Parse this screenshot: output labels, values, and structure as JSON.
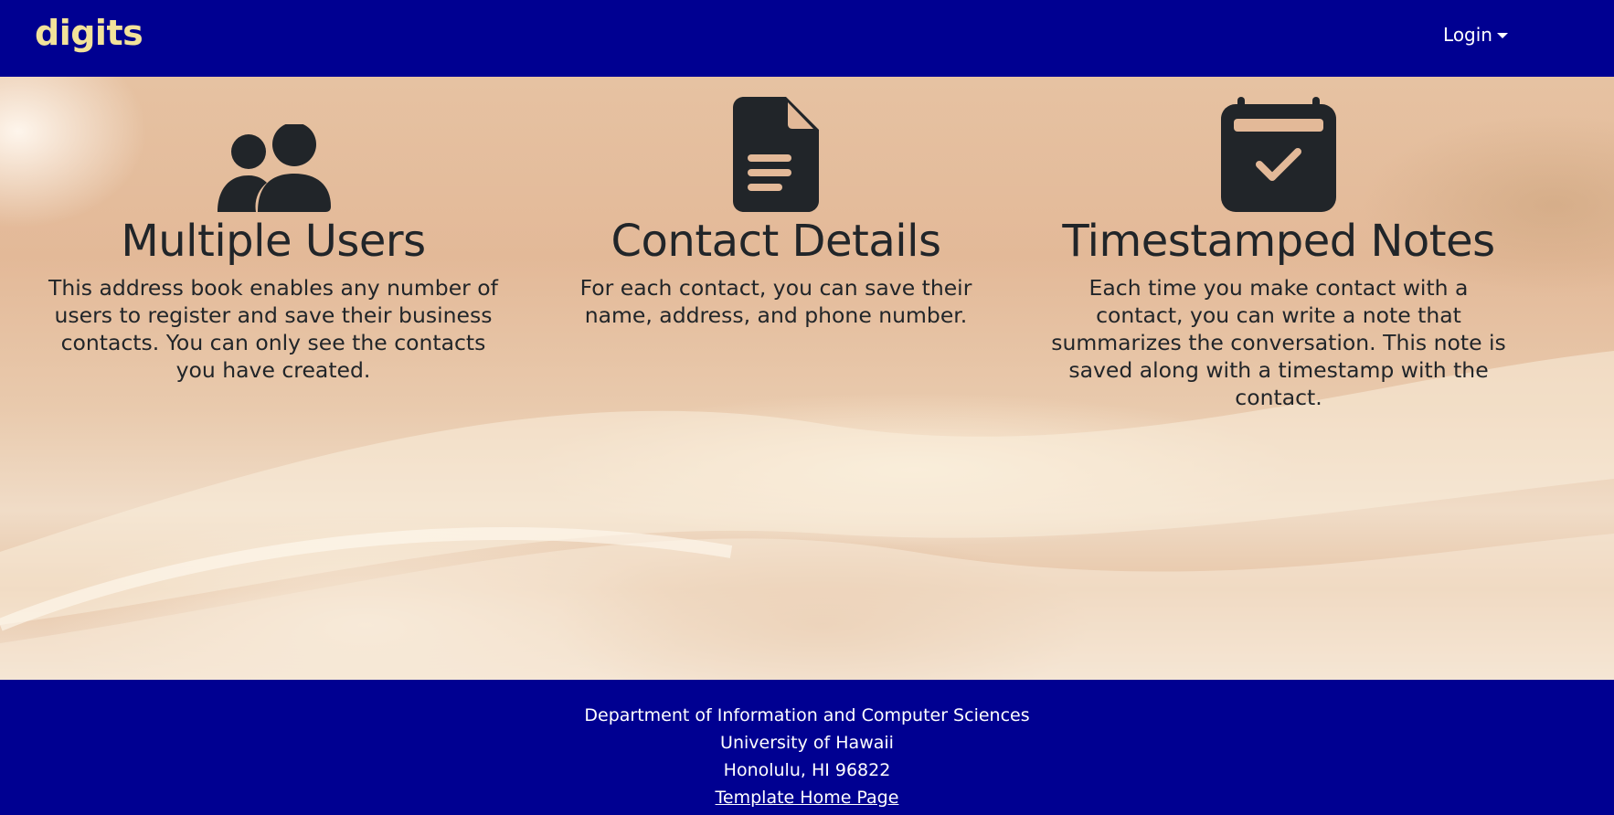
{
  "navbar": {
    "brand": "digits",
    "login_label": "Login",
    "colors": {
      "background": "#000091",
      "brand": "#f2e29a",
      "text": "#ffffff"
    }
  },
  "features": [
    {
      "icon": "users-icon",
      "title": "Multiple Users",
      "description": "This address book enables any number of users to register and save their business contacts. You can only see the contacts you have created."
    },
    {
      "icon": "file-text-icon",
      "title": "Contact Details",
      "description": "For each contact, you can save their name, address, and phone number."
    },
    {
      "icon": "calendar-check-icon",
      "title": "Timestamped Notes",
      "description": "Each time you make contact with a contact, you can write a note that summarizes the conversation. This note is saved along with a timestamp with the contact."
    }
  ],
  "footer": {
    "line1": "Department of Information and Computer Sciences",
    "line2": "University of Hawaii",
    "line3": "Honolulu, HI 96822",
    "link_label": "Template Home Page"
  }
}
